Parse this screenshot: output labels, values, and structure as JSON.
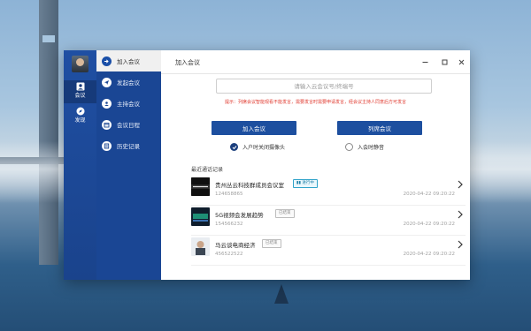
{
  "window": {
    "title": "加入会议"
  },
  "sidebar": {
    "rail": [
      {
        "label": "会议",
        "icon": "person-icon"
      },
      {
        "label": "发现",
        "icon": "compass-icon"
      }
    ],
    "menu": [
      {
        "label": "加入会议",
        "icon": "enter-icon"
      },
      {
        "label": "发起会议",
        "icon": "send-icon"
      },
      {
        "label": "主持会议",
        "icon": "host-icon"
      },
      {
        "label": "会议日程",
        "icon": "calendar-icon"
      },
      {
        "label": "历史记录",
        "icon": "history-icon"
      }
    ]
  },
  "join": {
    "placeholder": "请输入云会议号/终端号",
    "hint": "提示：列席会议智能观看不能发言，需要发言时需要申请发言，经会议主持人同意后方可发言",
    "join_button": "加入会议",
    "attend_button": "列席会议",
    "option_camera": {
      "label": "入户时关闭摄像头",
      "checked": true
    },
    "option_mute": {
      "label": "入会时静音",
      "checked": false
    }
  },
  "recent": {
    "title": "最近通话记录",
    "items": [
      {
        "name": "贵州丛云科技群成员会议室",
        "id": "124658865",
        "time": "2020-04-22 09:20:22",
        "status": "进行中",
        "status_kind": "live"
      },
      {
        "name": "5G视频会发展趋势",
        "id": "154566232",
        "time": "2020-04-22 09:20:22",
        "status": "已结束",
        "status_kind": "ended"
      },
      {
        "name": "马云谈电商经济",
        "id": "456522522",
        "time": "2020-04-22 09:20:22",
        "status": "已结束",
        "status_kind": "ended"
      }
    ]
  },
  "colors": {
    "primary": "#1d4f9f",
    "sidebar": "#1a4694",
    "rail": "#1f4fa3",
    "hint": "#e03a2f",
    "live": "#30a3c9"
  }
}
